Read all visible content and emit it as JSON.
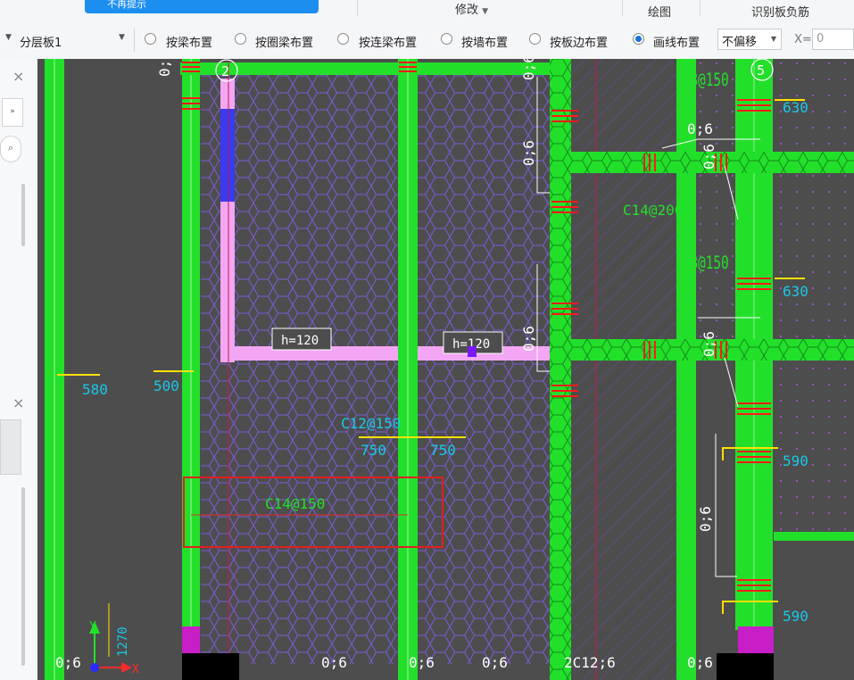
{
  "ribbon": {
    "tip_text": "不再提示",
    "modify_label": "修改",
    "draw_label": "绘图",
    "identify_label": "识别板负筋"
  },
  "toolbar": {
    "layer_select": "分层板1",
    "options": [
      {
        "label": "按梁布置",
        "selected": false
      },
      {
        "label": "按圈梁布置",
        "selected": false
      },
      {
        "label": "按连梁布置",
        "selected": false
      },
      {
        "label": "按墙布置",
        "selected": false
      },
      {
        "label": "按板边布置",
        "selected": false
      },
      {
        "label": "画线布置",
        "selected": true
      }
    ],
    "offset_select": "不偏移",
    "x_label": "X=",
    "x_value": "0"
  },
  "canvas": {
    "axis_labels": [
      "2",
      "5"
    ],
    "rebar_labels": {
      "c8_top": "C8@150",
      "c8_mid": "C8@150",
      "c14_200": "C14@200",
      "c12_150": "C12@150",
      "c14_150": "C14@150"
    },
    "dims": {
      "d630a": "630",
      "d630b": "630",
      "d580": "580",
      "d500": "500",
      "d750a": "750",
      "d750b": "750",
      "d590a": "590",
      "d590b": "590",
      "d1270": "1270"
    },
    "slab_labels": {
      "h1": "h=120",
      "h2": "h=120"
    },
    "bottom_labels": [
      "0;6",
      "0;6",
      "0;6",
      "0;6",
      "2C12;6",
      "0;6"
    ],
    "misc_labels": {
      "v1": "0;6",
      "v2": "0;6",
      "v3": "0;6",
      "v4": "0;6",
      "v5": "0;6",
      "v6": "0;6",
      "v7": "0;6",
      "v8": "0;6"
    },
    "ucs": {
      "x": "X",
      "y": "Y"
    }
  },
  "colors": {
    "beam_green": "#22e02a",
    "rebar_red": "#ff1a1a",
    "dim_cyan": "#19c8e8",
    "label_yellow": "#ffe000",
    "hatch_purple": "#7b5cd6",
    "highlight_box": "#e02020",
    "background": "#4d4d4d"
  }
}
